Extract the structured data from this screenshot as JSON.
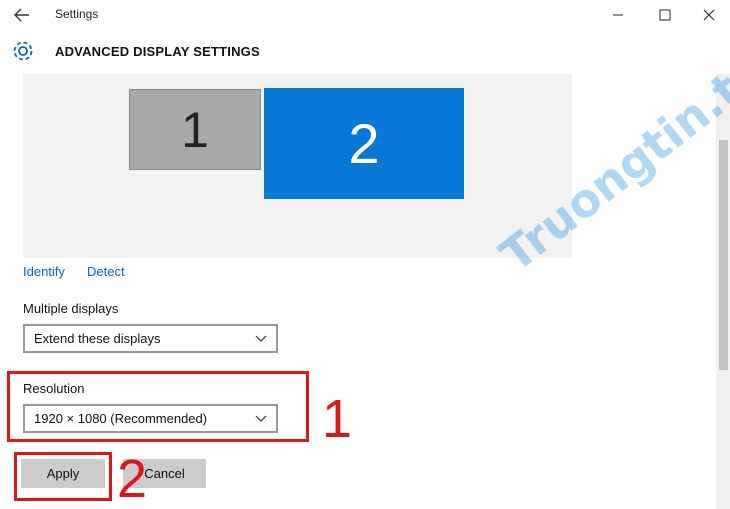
{
  "window": {
    "title": "Settings",
    "page_heading": "ADVANCED DISPLAY SETTINGS"
  },
  "displays": {
    "monitor1_label": "1",
    "monitor2_label": "2",
    "identify_link": "Identify",
    "detect_link": "Detect"
  },
  "multiple_displays": {
    "label": "Multiple displays",
    "selected": "Extend these displays"
  },
  "resolution": {
    "label": "Resolution",
    "selected": "1920 × 1080 (Recommended)"
  },
  "buttons": {
    "apply": "Apply",
    "cancel": "Cancel"
  },
  "annotations": {
    "step1": "1",
    "step2": "2",
    "color": "#e0151b"
  },
  "watermark": "Truongtin.top",
  "colors": {
    "accent": "#0a78d7",
    "link": "#0a64c8"
  },
  "icons": [
    "back-arrow-icon",
    "minimize-icon",
    "maximize-icon",
    "close-icon",
    "gear-icon",
    "chevron-down-icon"
  ]
}
